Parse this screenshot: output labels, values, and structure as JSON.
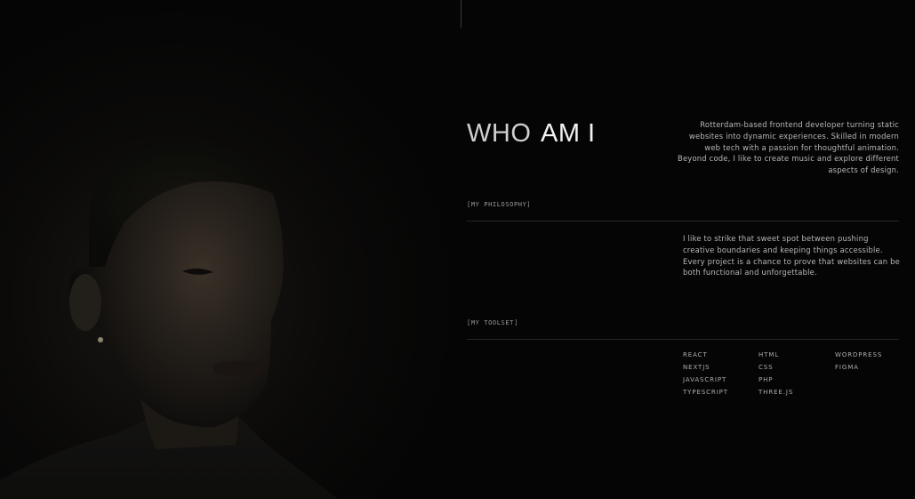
{
  "portrait": {
    "icon": "portrait-photo"
  },
  "heading": {
    "light": "WHO",
    "bold": "AM I"
  },
  "intro": "Rotterdam-based frontend developer turning static websites into dynamic experiences. Skilled in modern web tech with a passion for thoughtful animation. Beyond code, I like to create music and explore different aspects of design.",
  "philosophy": {
    "label": "[MY PHILOSOPHY]",
    "text": "I like to strike that sweet spot between pushing creative boundaries and keeping things accessible. Every project is a chance to prove that websites can be both functional and unforgettable."
  },
  "toolset": {
    "label": "[MY TOOLSET]",
    "columns": [
      [
        "REACT",
        "NEXTJS",
        "JAVASCRIPT",
        "TYPESCRIPT"
      ],
      [
        "HTML",
        "CSS",
        "PHP",
        "THREE.JS"
      ],
      [
        "WORDPRESS",
        "FIGMA"
      ]
    ]
  },
  "colors": {
    "background": "#050505",
    "text": "#b8b8b8",
    "heading": "#f2f2f2"
  }
}
